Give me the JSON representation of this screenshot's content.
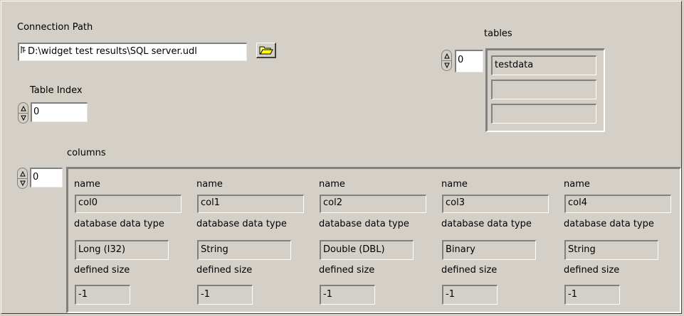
{
  "connection": {
    "label": "Connection Path",
    "path_value": "D:\\widget test results\\SQL server.udl",
    "path_icon": "path-icon",
    "browse_icon": "folder-open-icon"
  },
  "tables": {
    "label": "tables",
    "index_value": "0",
    "items": [
      "testdata",
      "",
      ""
    ]
  },
  "table_index": {
    "label": "Table Index",
    "value": "0"
  },
  "columns": {
    "label": "columns",
    "index_value": "0",
    "name_label": "name",
    "type_label": "database data type",
    "size_label": "defined size",
    "items": [
      {
        "name": "col0",
        "type": "Long (I32)",
        "size": "-1"
      },
      {
        "name": "col1",
        "type": "String",
        "size": "-1"
      },
      {
        "name": "col2",
        "type": "Double (DBL)",
        "size": "-1"
      },
      {
        "name": "col3",
        "type": "Binary",
        "size": "-1"
      },
      {
        "name": "col4",
        "type": "String",
        "size": "-1"
      }
    ]
  }
}
